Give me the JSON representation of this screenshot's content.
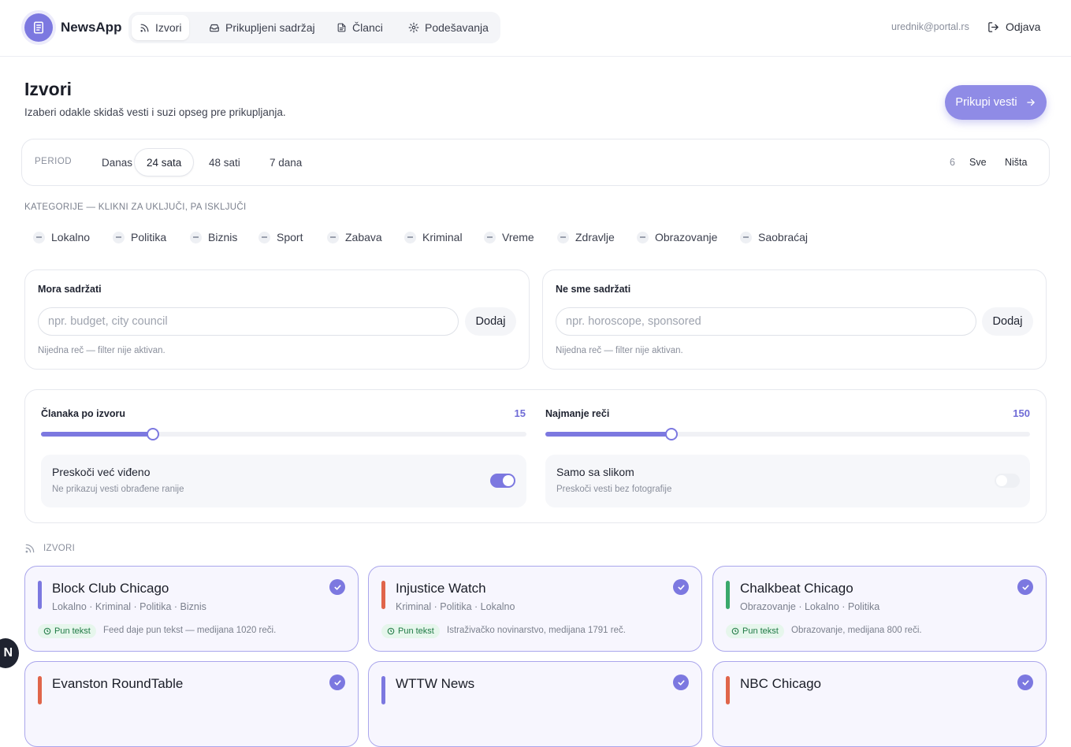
{
  "app": {
    "name": "NewsApp"
  },
  "nav": {
    "tabs": [
      {
        "label": "Izvori",
        "icon": "rss-icon",
        "active": true
      },
      {
        "label": "Prikupljeni sadržaj",
        "icon": "inbox-icon"
      },
      {
        "label": "Članci",
        "icon": "document-icon"
      },
      {
        "label": "Podešavanja",
        "icon": "gear-icon"
      }
    ]
  },
  "user": {
    "email": "urednik@portal.rs",
    "logout_label": "Odjava"
  },
  "page": {
    "title": "Izvori",
    "subtitle": "Izaberi odakle skidaš vesti i suzi opseg pre prikupljanja.",
    "cta_label": "Prikupi vesti"
  },
  "period": {
    "label": "PERIOD",
    "options": [
      "Danas",
      "24 sata",
      "48 sati",
      "7 dana"
    ],
    "selected": "24 sata",
    "selected_count": "6",
    "all_label": "Sve",
    "none_label": "Ništa"
  },
  "categories": {
    "label": "KATEGORIJE — KLIKNI ZA UKLJUČI, PA ISKLJUČI",
    "items": [
      "Lokalno",
      "Politika",
      "Biznis",
      "Sport",
      "Zabava",
      "Kriminal",
      "Vreme",
      "Zdravlje",
      "Obrazovanje",
      "Saobraćaj"
    ]
  },
  "filters": {
    "include": {
      "label": "Mora sadržati",
      "placeholder": "npr. budget, city council",
      "button": "Dodaj",
      "hint": "Nijedna reč — filter nije aktivan."
    },
    "exclude": {
      "label": "Ne sme sadržati",
      "placeholder": "npr. horoscope, sponsored",
      "button": "Dodaj",
      "hint": "Nijedna reč — filter nije aktivan."
    }
  },
  "settings": {
    "articles_per_source": {
      "label": "Članaka po izvoru",
      "value": "15",
      "fraction": 0.23
    },
    "min_words": {
      "label": "Najmanje reči",
      "value": "150",
      "fraction": 0.26
    },
    "skip_seen": {
      "title": "Preskoči već viđeno",
      "subtitle": "Ne prikazuj vesti obrađene ranije",
      "on": true
    },
    "images_only": {
      "title": "Samo sa slikom",
      "subtitle": "Preskoči vesti bez fotografije",
      "on": false
    }
  },
  "sources": {
    "label": "IZVORI",
    "badge_label": "Pun tekst",
    "cards": [
      {
        "name": "Block Club Chicago",
        "categories": "Lokalno · Kriminal · Politika · Biznis",
        "desc": "Feed daje pun tekst — medijana 1020 reči.",
        "color": "#7c78e0",
        "checked": true
      },
      {
        "name": "Injustice Watch",
        "categories": "Kriminal · Politika · Lokalno",
        "desc": "Istraživačko novinarstvo, medijana 1791 reč.",
        "color": "#e0654a",
        "checked": true
      },
      {
        "name": "Chalkbeat Chicago",
        "categories": "Obrazovanje · Lokalno · Politika",
        "desc": "Obrazovanje, medijana 800 reči.",
        "color": "#3aa86b",
        "checked": true
      },
      {
        "name": "Evanston RoundTable",
        "color": "#e0654a",
        "checked": true
      },
      {
        "name": "WTTW News",
        "color": "#7c78e0",
        "checked": true
      },
      {
        "name": "NBC Chicago",
        "color": "#e0654a",
        "checked": true
      }
    ]
  },
  "corner_badge": "N"
}
